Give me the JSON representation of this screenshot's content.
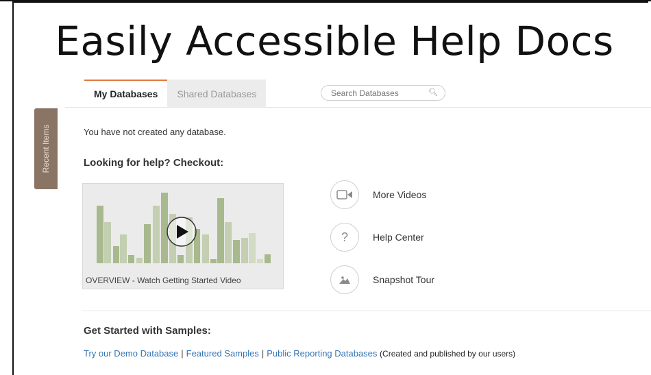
{
  "slide": {
    "title": "Easily Accessible Help Docs"
  },
  "tabs": [
    {
      "label": "My Databases",
      "active": true
    },
    {
      "label": "Shared Databases",
      "active": false
    }
  ],
  "search": {
    "placeholder": "Search Databases",
    "icon": "search-icon"
  },
  "sidebar": {
    "recent_label": "Recent Items"
  },
  "main": {
    "empty_message": "You have not created any database.",
    "help_heading": "Looking for help? Checkout:",
    "video": {
      "caption": "OVERVIEW - Watch Getting Started Video",
      "play_icon": "play-icon"
    },
    "help_links": [
      {
        "label": "More Videos",
        "icon": "video-camera-icon"
      },
      {
        "label": "Help Center",
        "icon": "question-mark-icon"
      },
      {
        "label": "Snapshot Tour",
        "icon": "mountain-image-icon"
      }
    ],
    "samples_heading": "Get Started with Samples:",
    "samples": {
      "links": [
        "Try our Demo Database",
        "Featured Samples",
        "Public Reporting Databases"
      ],
      "separator": "|",
      "note": "(Created and published by our users)"
    }
  },
  "colors": {
    "accent_tab": "#e07a3f",
    "link": "#3474b5",
    "sidebar": "#8a7565",
    "bar_green": "#a8b98e"
  }
}
